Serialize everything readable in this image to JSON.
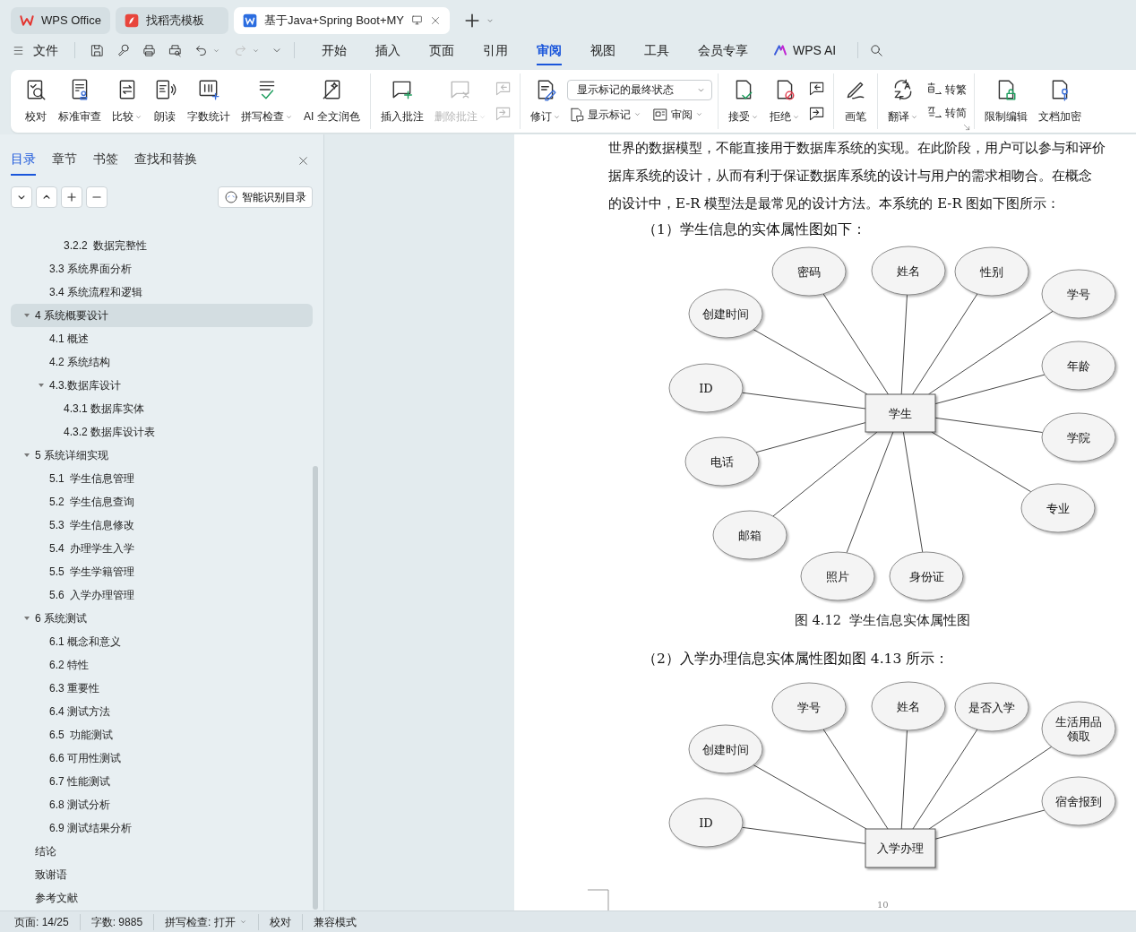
{
  "title_bar": {
    "tabs": [
      {
        "kind": "home",
        "label": "WPS Office",
        "selected": false
      },
      {
        "kind": "template",
        "label": "找稻壳模板",
        "selected": false
      },
      {
        "kind": "document",
        "label": "基于Java+Spring Boot+MY",
        "selected": true
      }
    ]
  },
  "menu_bar": {
    "file_label": "文件",
    "tabs": [
      {
        "label": "开始",
        "selected": false
      },
      {
        "label": "插入",
        "selected": false
      },
      {
        "label": "页面",
        "selected": false
      },
      {
        "label": "引用",
        "selected": false
      },
      {
        "label": "审阅",
        "selected": true
      },
      {
        "label": "视图",
        "selected": false
      },
      {
        "label": "工具",
        "selected": false
      },
      {
        "label": "会员专享",
        "selected": false
      }
    ],
    "ai_label": "WPS AI"
  },
  "ribbon": {
    "groups": [
      {
        "columns": [
          [
            [
              {
                "kind": "large",
                "label": "校对",
                "disabled": false
              }
            ]
          ],
          [
            [
              {
                "kind": "large",
                "label": "标准审查",
                "disabled": false
              }
            ]
          ],
          [
            [
              {
                "kind": "large",
                "label": "比较",
                "dropdown": true,
                "disabled": false
              }
            ]
          ],
          [
            [
              {
                "kind": "large",
                "label": "朗读",
                "disabled": false
              }
            ]
          ],
          [
            [
              {
                "kind": "large",
                "label": "字数统计",
                "disabled": false
              }
            ]
          ],
          [
            [
              {
                "kind": "large",
                "label": "拼写检查",
                "dropdown": true,
                "disabled": false
              }
            ]
          ],
          [
            [
              {
                "kind": "large",
                "label": "AI 全文润色",
                "disabled": false
              }
            ]
          ]
        ]
      },
      {
        "columns": [
          [
            [
              {
                "kind": "large",
                "label": "插入批注",
                "disabled": false
              }
            ]
          ],
          [
            [
              {
                "kind": "large",
                "label": "删除批注",
                "dropdown": true,
                "disabled": true
              }
            ]
          ],
          [
            [
              {
                "kind": "icon",
                "disabled": true
              }
            ],
            [
              {
                "kind": "icon",
                "disabled": true
              }
            ]
          ]
        ]
      },
      {
        "columns": [
          [
            [
              {
                "kind": "large",
                "label": "修订",
                "dropdown": true,
                "disabled": false
              }
            ]
          ],
          [
            [
              {
                "kind": "select",
                "value": "显示标记的最终状态",
                "disabled": false
              }
            ],
            [
              {
                "kind": "small",
                "label": "显示标记",
                "dropdown": true,
                "disabled": false
              },
              {
                "kind": "small",
                "label": "审阅",
                "dropdown": true,
                "disabled": false
              }
            ]
          ]
        ]
      },
      {
        "columns": [
          [
            [
              {
                "kind": "large",
                "label": "接受",
                "dropdown": true,
                "disabled": false
              }
            ]
          ],
          [
            [
              {
                "kind": "large",
                "label": "拒绝",
                "dropdown": true,
                "disabled": false
              }
            ]
          ],
          [
            [
              {
                "kind": "icon",
                "disabled": false
              }
            ],
            [
              {
                "kind": "icon",
                "disabled": false
              }
            ]
          ]
        ]
      },
      {
        "columns": [
          [
            [
              {
                "kind": "large",
                "label": "画笔",
                "disabled": false
              }
            ]
          ]
        ]
      },
      {
        "launcher": true,
        "columns": [
          [
            [
              {
                "kind": "large",
                "label": "翻译",
                "dropdown": true,
                "disabled": false
              }
            ]
          ],
          [
            [
              {
                "kind": "small",
                "label": "转繁",
                "disabled": false
              }
            ],
            [
              {
                "kind": "small",
                "label": "转简",
                "disabled": false
              }
            ]
          ]
        ]
      },
      {
        "columns": [
          [
            [
              {
                "kind": "large",
                "label": "限制编辑",
                "disabled": false
              }
            ]
          ],
          [
            [
              {
                "kind": "large",
                "label": "文档加密",
                "disabled": false
              }
            ]
          ]
        ]
      }
    ]
  },
  "sidebar": {
    "tabs": [
      {
        "label": "目录",
        "selected": true
      },
      {
        "label": "章节",
        "selected": false
      },
      {
        "label": "书签",
        "selected": false
      },
      {
        "label": "查找和替换",
        "selected": false
      }
    ],
    "smart_toc_label": "智能识别目录",
    "toc": [
      {
        "children": [
          {
            "children": [
              {
                "label": "3.2.2  数据完整性",
                "selected": false
              }
            ]
          },
          {
            "label": "3.3 系统界面分析",
            "selected": false
          },
          {
            "label": "3.4 系统流程和逻辑",
            "selected": false
          }
        ]
      },
      {
        "label": "4 系统概要设计",
        "selected": true,
        "expanded": true,
        "children": [
          {
            "label": "4.1 概述",
            "selected": false
          },
          {
            "label": "4.2 系统结构",
            "selected": false
          },
          {
            "label": "4.3.数据库设计",
            "selected": false,
            "expanded": true,
            "children": [
              {
                "label": "4.3.1 数据库实体",
                "selected": false
              },
              {
                "label": "4.3.2 数据库设计表",
                "selected": false
              }
            ]
          }
        ]
      },
      {
        "label": "5 系统详细实现",
        "selected": false,
        "expanded": true,
        "children": [
          {
            "label": "5.1  学生信息管理",
            "selected": false
          },
          {
            "label": "5.2  学生信息查询",
            "selected": false
          },
          {
            "label": "5.3  学生信息修改",
            "selected": false
          },
          {
            "label": "5.4  办理学生入学",
            "selected": false
          },
          {
            "label": "5.5  学生学籍管理",
            "selected": false
          },
          {
            "label": "5.6  入学办理管理",
            "selected": false
          }
        ]
      },
      {
        "label": "6 系统测试",
        "selected": false,
        "expanded": true,
        "children": [
          {
            "label": "6.1 概念和意义",
            "selected": false
          },
          {
            "label": "6.2 特性",
            "selected": false
          },
          {
            "label": "6.3 重要性",
            "selected": false
          },
          {
            "label": "6.4 测试方法",
            "selected": false
          },
          {
            "label": "6.5  功能测试",
            "selected": false
          },
          {
            "label": "6.6 可用性测试",
            "selected": false
          },
          {
            "label": "6.7 性能测试",
            "selected": false
          },
          {
            "label": "6.8 测试分析",
            "selected": false
          },
          {
            "label": "6.9 测试结果分析",
            "selected": false
          }
        ]
      },
      {
        "label": "结论",
        "selected": false
      },
      {
        "label": "致谢语",
        "selected": false
      },
      {
        "label": "参考文献",
        "selected": false
      }
    ]
  },
  "document": {
    "blocks": [
      {
        "kind": "line",
        "text": "世界的数据模型，不能直接用于数据库系统的实现。在此阶段，用户可以参与和评价"
      },
      {
        "kind": "line",
        "text": "据库系统的设计，从而有利于保证数据库系统的设计与用户的需求相吻合。在概念"
      },
      {
        "kind": "line",
        "text": "的设计中，E-R 模型法是最常见的设计方法。本系统的 E-R 图如下图所示："
      },
      {
        "kind": "indent-line",
        "text": "（1）学生信息的实体属性图如下："
      },
      {
        "kind": "er-diagram",
        "entity": "学生",
        "attributes": [
          "密码",
          "姓名",
          "性别",
          "创建时间",
          "学号",
          "年龄",
          "ID",
          "学院",
          "电话",
          "专业",
          "邮箱",
          "照片",
          "身份证"
        ]
      },
      {
        "kind": "caption",
        "text": "图 4.12  学生信息实体属性图"
      },
      {
        "kind": "indent-line",
        "text": "（2）入学办理信息实体属性图如图 4.13 所示："
      },
      {
        "kind": "er-diagram",
        "entity": "入学办理",
        "attributes": [
          "学号",
          "姓名",
          "是否入学",
          "创建时间",
          "生活用品领取",
          "宿舍报到",
          "ID"
        ]
      },
      {
        "kind": "page-number",
        "text": "10"
      }
    ]
  },
  "status_bar": {
    "items": [
      {
        "kind": "text",
        "label": "页面: 14/25"
      },
      {
        "kind": "text",
        "label": "字数: 9885"
      },
      {
        "kind": "dropdown",
        "label": "拼写检查: 打开"
      },
      {
        "kind": "button",
        "label": "校对"
      },
      {
        "kind": "text",
        "label": "兼容模式"
      }
    ]
  }
}
